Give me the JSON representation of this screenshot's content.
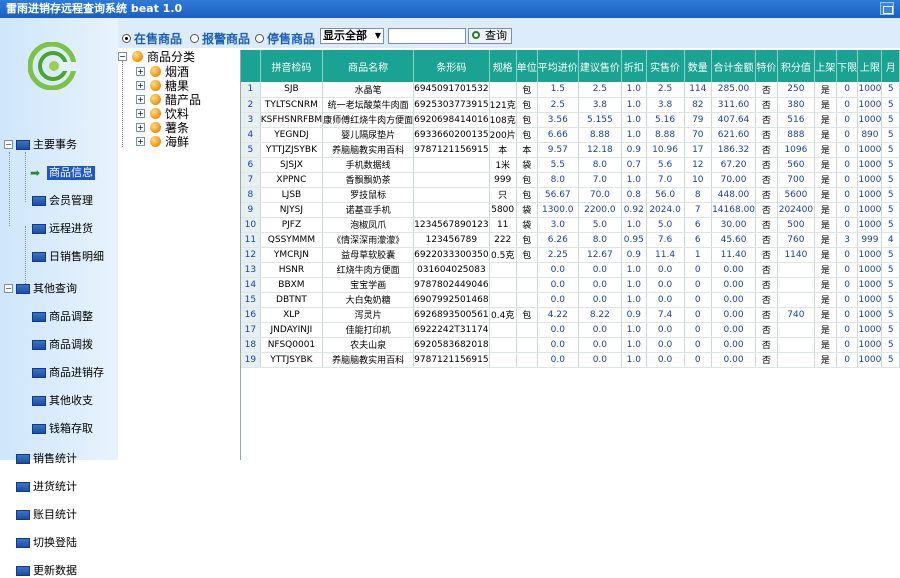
{
  "window": {
    "title": "雷雨进销存远程查询系统 beat 1.0"
  },
  "filters": {
    "radios": [
      {
        "label": "在售商品",
        "selected": true
      },
      {
        "label": "报警商品",
        "selected": false
      },
      {
        "label": "停售商品",
        "selected": false
      }
    ],
    "select_value": "显示全部",
    "search_value": "",
    "query_label": "查询"
  },
  "nav": {
    "groups": [
      {
        "label": "主要事务",
        "items": [
          "商品信息",
          "会员管理",
          "远程进货",
          "日销售明细"
        ]
      },
      {
        "label": "其他查询",
        "items": [
          "商品调整",
          "商品调拨",
          "商品进销存",
          "其他收支",
          "钱箱存取"
        ]
      }
    ],
    "extra": [
      "销售统计",
      "进货统计",
      "账目统计",
      "切换登陆",
      "更新数据"
    ],
    "selected": "商品信息"
  },
  "categories": {
    "root": "商品分类",
    "items": [
      "烟酒",
      "糖果",
      "醋产品",
      "饮料",
      "薯条",
      "海鲜"
    ]
  },
  "table": {
    "headers": [
      "",
      "拼音检码",
      "商品名称",
      "条形码",
      "规格",
      "单位",
      "平均进价",
      "建议售价",
      "折扣",
      "实售价",
      "数量",
      "合计金额",
      "特价",
      "积分值",
      "上架",
      "下限",
      "上限",
      "月"
    ],
    "rows": [
      [
        "1",
        "SJB",
        "水晶笔",
        "6945091701532",
        "",
        "包",
        "1.5",
        "2.5",
        "1.0",
        "2.5",
        "114",
        "285.00",
        "否",
        "250",
        "是",
        "0",
        "1000",
        "5"
      ],
      [
        "2",
        "TYLTSCNRM",
        "统一老坛酸菜牛肉面",
        "6925303773915",
        "121克",
        "包",
        "2.5",
        "3.8",
        "1.0",
        "3.8",
        "82",
        "311.60",
        "否",
        "380",
        "是",
        "0",
        "1000",
        "5"
      ],
      [
        "3",
        "KSFHSNRFBM",
        "康师傅红烧牛肉方便面",
        "6920698414016",
        "108克",
        "包",
        "3.56",
        "5.155",
        "1.0",
        "5.16",
        "79",
        "407.64",
        "否",
        "516",
        "是",
        "0",
        "1000",
        "5"
      ],
      [
        "4",
        "YEGNDJ",
        "婴儿隔尿垫片",
        "6933660200135",
        "200片",
        "包",
        "6.66",
        "8.88",
        "1.0",
        "8.88",
        "70",
        "621.60",
        "否",
        "888",
        "是",
        "0",
        "890",
        "5"
      ],
      [
        "5",
        "YTTJZJSYBK",
        "养脑脑教实用百科",
        "9787121156915",
        "本",
        "本",
        "9.57",
        "12.18",
        "0.9",
        "10.96",
        "17",
        "186.32",
        "否",
        "1096",
        "是",
        "0",
        "1000",
        "5"
      ],
      [
        "6",
        "SJSJX",
        "手机数据线",
        "",
        "1米",
        "袋",
        "5.5",
        "8.0",
        "0.7",
        "5.6",
        "12",
        "67.20",
        "否",
        "560",
        "是",
        "0",
        "1000",
        "5"
      ],
      [
        "7",
        "XPPNC",
        "香飘飘奶茶",
        "",
        "999",
        "包",
        "8.0",
        "7.0",
        "1.0",
        "7.0",
        "10",
        "70.00",
        "否",
        "700",
        "是",
        "0",
        "1000",
        "5"
      ],
      [
        "8",
        "LJSB",
        "罗技鼠标",
        "",
        "只",
        "包",
        "56.67",
        "70.0",
        "0.8",
        "56.0",
        "8",
        "448.00",
        "否",
        "5600",
        "是",
        "0",
        "1000",
        "5"
      ],
      [
        "9",
        "NJYSJ",
        "诺基亚手机",
        "",
        "5800",
        "袋",
        "1300.0",
        "2200.0",
        "0.92",
        "2024.0",
        "7",
        "14168.00",
        "否",
        "202400",
        "是",
        "0",
        "1000",
        "5"
      ],
      [
        "10",
        "PJFZ",
        "泡椒凤爪",
        "1234567890123",
        "11",
        "袋",
        "3.0",
        "5.0",
        "1.0",
        "5.0",
        "6",
        "30.00",
        "否",
        "500",
        "是",
        "0",
        "1000",
        "5"
      ],
      [
        "11",
        "QSSYMMM",
        "《情深深雨濛濛》",
        "123456789",
        "222",
        "包",
        "6.26",
        "8.0",
        "0.95",
        "7.6",
        "6",
        "45.60",
        "否",
        "760",
        "是",
        "3",
        "999",
        "4"
      ],
      [
        "12",
        "YMCRJN",
        "益母草软胶囊",
        "6922033300350",
        "0.5克",
        "包",
        "2.25",
        "12.67",
        "0.9",
        "11.4",
        "1",
        "11.40",
        "否",
        "1140",
        "是",
        "0",
        "1000",
        "5"
      ],
      [
        "13",
        "HSNR",
        "红烧牛肉方便面",
        "031604025083",
        "",
        "",
        "0.0",
        "0.0",
        "1.0",
        "0.0",
        "0",
        "0.00",
        "否",
        "",
        "是",
        "0",
        "1000",
        "5"
      ],
      [
        "14",
        "BBXM",
        "宝宝学画",
        "9787802449046",
        "",
        "",
        "0.0",
        "0.0",
        "1.0",
        "0.0",
        "0",
        "0.00",
        "否",
        "",
        "是",
        "0",
        "1000",
        "5"
      ],
      [
        "15",
        "DBTNT",
        "大白兔奶糖",
        "6907992501468",
        "",
        "",
        "0.0",
        "0.0",
        "1.0",
        "0.0",
        "0",
        "0.00",
        "否",
        "",
        "是",
        "0",
        "1000",
        "5"
      ],
      [
        "16",
        "XLP",
        "泻灵片",
        "6926893500561",
        "0.4克",
        "包",
        "4.22",
        "8.22",
        "0.9",
        "7.4",
        "0",
        "0.00",
        "否",
        "740",
        "是",
        "0",
        "1000",
        "5"
      ],
      [
        "17",
        "JNDAYINJI",
        "佳能打印机",
        "6922242T31174",
        "",
        "",
        "0.0",
        "0.0",
        "1.0",
        "0.0",
        "0",
        "0.00",
        "否",
        "",
        "是",
        "0",
        "1000",
        "5"
      ],
      [
        "18",
        "NFSQ0001",
        "农夫山泉",
        "6920583682018",
        "",
        "",
        "0.0",
        "0.0",
        "1.0",
        "0.0",
        "0",
        "0.00",
        "否",
        "",
        "是",
        "0",
        "1000",
        "5"
      ],
      [
        "19",
        "YTTJSYBK",
        "养脑脑教实用百科",
        "9787121156915",
        "",
        "",
        "0.0",
        "0.0",
        "1.0",
        "0.0",
        "0",
        "0.00",
        "否",
        "",
        "是",
        "0",
        "1000",
        "5"
      ]
    ]
  },
  "colors": {
    "header": "#1aa392",
    "title": "#1b5fc0",
    "selected": "#1c56c9"
  }
}
